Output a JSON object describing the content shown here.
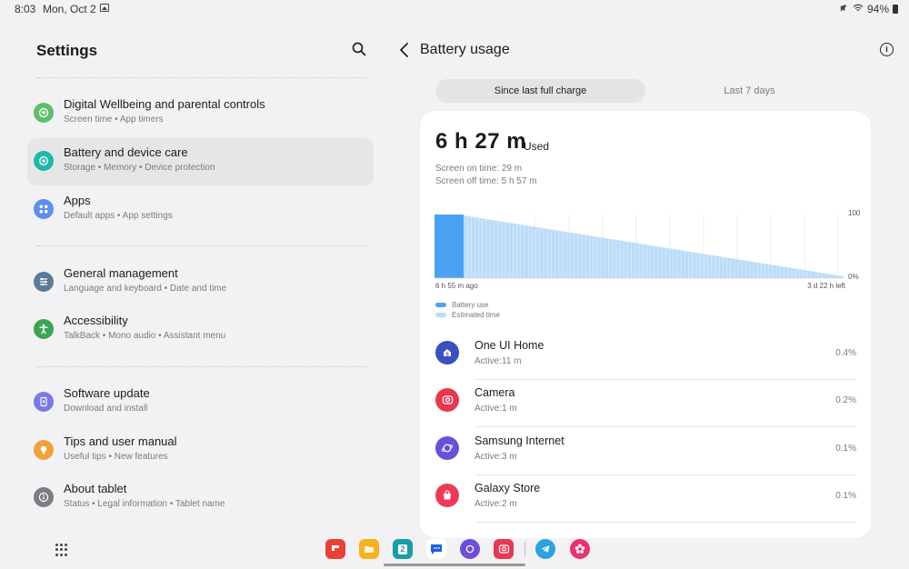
{
  "status": {
    "time": "8:03",
    "date": "Mon, Oct 2",
    "battery": "94%"
  },
  "left": {
    "title": "Settings",
    "items": [
      {
        "title": "Digital Wellbeing and parental controls",
        "subtitle": "Screen time  •  App timers",
        "color": "#5cbf6a"
      },
      {
        "title": "Battery and device care",
        "subtitle": "Storage  •  Memory  •  Device protection",
        "color": "#1fb7a8"
      },
      {
        "title": "Apps",
        "subtitle": "Default apps  •  App settings",
        "color": "#5d8ef0"
      },
      {
        "title": "General management",
        "subtitle": "Language and keyboard  •  Date and time",
        "color": "#5c7a99"
      },
      {
        "title": "Accessibility",
        "subtitle": "TalkBack  •  Mono audio  •  Assistant menu",
        "color": "#3aa552"
      },
      {
        "title": "Software update",
        "subtitle": "Download and install",
        "color": "#7b79e6"
      },
      {
        "title": "Tips and user manual",
        "subtitle": "Useful tips  •  New features",
        "color": "#f1a33b"
      },
      {
        "title": "About tablet",
        "subtitle": "Status  •  Legal information  •  Tablet name",
        "color": "#7d7d82"
      }
    ]
  },
  "right": {
    "title": "Battery usage",
    "tabs": {
      "active": "Since last full charge",
      "inactive": "Last 7 days"
    },
    "used_value": "6 h 27 m",
    "used_label": "Used",
    "screen_on": "Screen on time: 29 m",
    "screen_off": "Screen off time: 5 h 57 m",
    "chart": {
      "x_start": "6 h 55 m ago",
      "x_end": "3 d 22 h left",
      "y_top": "100",
      "y_bottom": "0%",
      "legend_used": "Battery use",
      "legend_est": "Estimated time",
      "used_color": "#4aa3f2",
      "est_color": "#bcdcf8"
    },
    "apps": [
      {
        "name": "One UI Home",
        "active": "Active:11 m",
        "percent": "0.4%",
        "color": "#3b4fbf",
        "glyph": "S"
      },
      {
        "name": "Camera",
        "active": "Active:1 m",
        "percent": "0.2%",
        "color": "#e8374f",
        "glyph": "◉"
      },
      {
        "name": "Samsung Internet",
        "active": "Active:3 m",
        "percent": "0.1%",
        "color": "#6a4fd8",
        "glyph": "◐"
      },
      {
        "name": "Galaxy Store",
        "active": "Active:2 m",
        "percent": "0.1%",
        "color": "#ef3a57",
        "glyph": "◘"
      }
    ]
  },
  "dock": {
    "apps": [
      {
        "name": "flipboard",
        "color": "#e8413a",
        "label": ""
      },
      {
        "name": "files",
        "color": "#f6b21f",
        "label": ""
      },
      {
        "name": "calendar",
        "color": "#1d9ba6",
        "label": "2"
      },
      {
        "name": "messages",
        "color": "#ffffff",
        "label": ""
      },
      {
        "name": "internet",
        "color": "#6a4fd8",
        "label": ""
      },
      {
        "name": "camera",
        "color": "#e8374f",
        "label": ""
      },
      {
        "name": "telegram",
        "color": "#2aa3de",
        "label": ""
      },
      {
        "name": "blossom",
        "color": "#e8336e",
        "label": ""
      }
    ]
  }
}
